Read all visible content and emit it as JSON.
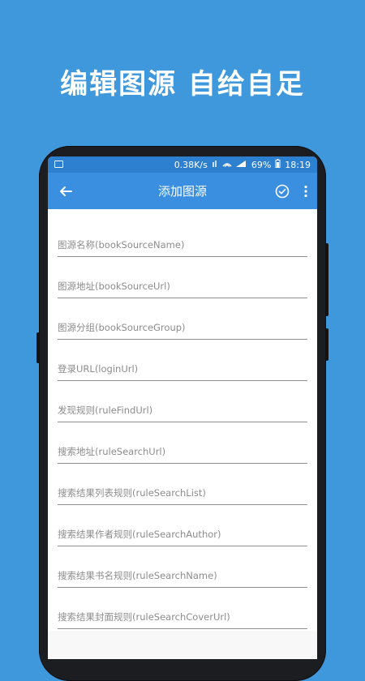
{
  "promo": {
    "headline": "编辑图源  自给自足"
  },
  "status_bar": {
    "network_speed": "0.38K/s",
    "signal": "ᴺ ᴴ ≡",
    "battery": "69%",
    "time": "18:19"
  },
  "app_bar": {
    "title": "添加图源",
    "back_icon": "arrow-left-icon",
    "confirm_icon": "check-circle-icon",
    "more_icon": "more-vertical-icon"
  },
  "form": {
    "fields": [
      {
        "placeholder": "图源名称(bookSourceName)"
      },
      {
        "placeholder": "图源地址(bookSourceUrl)"
      },
      {
        "placeholder": "图源分组(bookSourceGroup)"
      },
      {
        "placeholder": "登录URL(loginUrl)"
      },
      {
        "placeholder": "发现规则(ruleFindUrl)"
      },
      {
        "placeholder": "搜索地址(ruleSearchUrl)"
      },
      {
        "placeholder": "搜索结果列表规则(ruleSearchList)"
      },
      {
        "placeholder": "搜索结果作者规则(ruleSearchAuthor)"
      },
      {
        "placeholder": "搜索结果书名规则(ruleSearchName)"
      },
      {
        "placeholder": "搜索结果封面规则(ruleSearchCoverUrl)"
      }
    ]
  },
  "colors": {
    "background": "#3f97dc",
    "app_bar": "#3a8fe0",
    "status_bar": "#2d7fd0"
  }
}
